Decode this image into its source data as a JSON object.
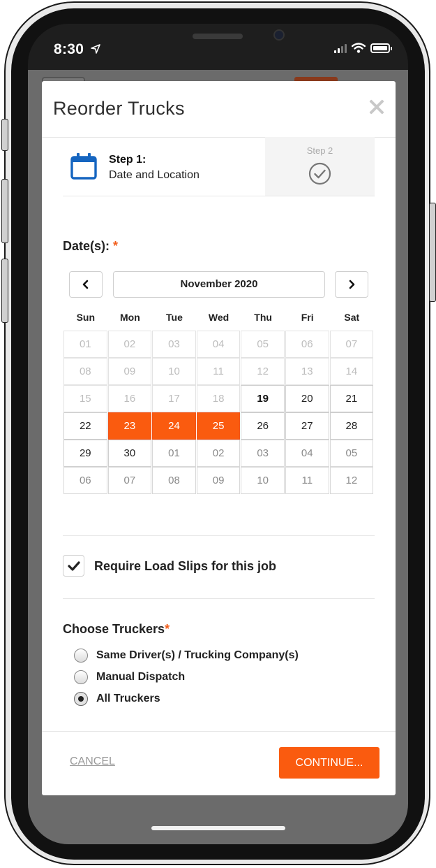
{
  "status_bar": {
    "time": "8:30"
  },
  "modal": {
    "title": "Reorder Trucks",
    "close_icon": "close-icon"
  },
  "steps": {
    "step1": {
      "number": "Step 1:",
      "label": "Date and Location",
      "icon": "calendar-icon"
    },
    "step2": {
      "number": "Step 2",
      "icon": "check-circle-icon"
    }
  },
  "dates": {
    "label": "Date(s):",
    "required_mark": "*",
    "month": "November 2020",
    "weekdays": [
      "Sun",
      "Mon",
      "Tue",
      "Wed",
      "Thu",
      "Fri",
      "Sat"
    ],
    "days": [
      {
        "label": "01",
        "state": "past"
      },
      {
        "label": "02",
        "state": "past"
      },
      {
        "label": "03",
        "state": "past"
      },
      {
        "label": "04",
        "state": "past"
      },
      {
        "label": "05",
        "state": "past"
      },
      {
        "label": "06",
        "state": "past"
      },
      {
        "label": "07",
        "state": "past"
      },
      {
        "label": "08",
        "state": "past"
      },
      {
        "label": "09",
        "state": "past"
      },
      {
        "label": "10",
        "state": "past"
      },
      {
        "label": "11",
        "state": "past"
      },
      {
        "label": "12",
        "state": "past"
      },
      {
        "label": "13",
        "state": "past"
      },
      {
        "label": "14",
        "state": "past"
      },
      {
        "label": "15",
        "state": "past"
      },
      {
        "label": "16",
        "state": "past"
      },
      {
        "label": "17",
        "state": "past"
      },
      {
        "label": "18",
        "state": "past"
      },
      {
        "label": "19",
        "state": "today"
      },
      {
        "label": "20",
        "state": "active"
      },
      {
        "label": "21",
        "state": "active"
      },
      {
        "label": "22",
        "state": "active"
      },
      {
        "label": "23",
        "state": "selected"
      },
      {
        "label": "24",
        "state": "selected"
      },
      {
        "label": "25",
        "state": "selected"
      },
      {
        "label": "26",
        "state": "active"
      },
      {
        "label": "27",
        "state": "active"
      },
      {
        "label": "28",
        "state": "active"
      },
      {
        "label": "29",
        "state": "active"
      },
      {
        "label": "30",
        "state": "active"
      },
      {
        "label": "01",
        "state": "next-month"
      },
      {
        "label": "02",
        "state": "next-month"
      },
      {
        "label": "03",
        "state": "next-month"
      },
      {
        "label": "04",
        "state": "next-month"
      },
      {
        "label": "05",
        "state": "next-month"
      },
      {
        "label": "06",
        "state": "next-month"
      },
      {
        "label": "07",
        "state": "next-month"
      },
      {
        "label": "08",
        "state": "next-month"
      },
      {
        "label": "09",
        "state": "next-month"
      },
      {
        "label": "10",
        "state": "next-month"
      },
      {
        "label": "11",
        "state": "next-month"
      },
      {
        "label": "12",
        "state": "next-month"
      }
    ]
  },
  "load_slips": {
    "label": "Require Load Slips for this job",
    "checked": true
  },
  "truckers": {
    "label": "Choose Truckers",
    "required_mark": "*",
    "options": [
      {
        "label": "Same Driver(s) / Trucking Company(s)",
        "selected": false
      },
      {
        "label": "Manual Dispatch",
        "selected": false
      },
      {
        "label": "All Truckers",
        "selected": true
      }
    ]
  },
  "footer": {
    "cancel_label": "CANCEL",
    "continue_label": "CONTINUE..."
  },
  "colors": {
    "accent": "#fa5b0f",
    "calendar_icon": "#1565c0"
  }
}
